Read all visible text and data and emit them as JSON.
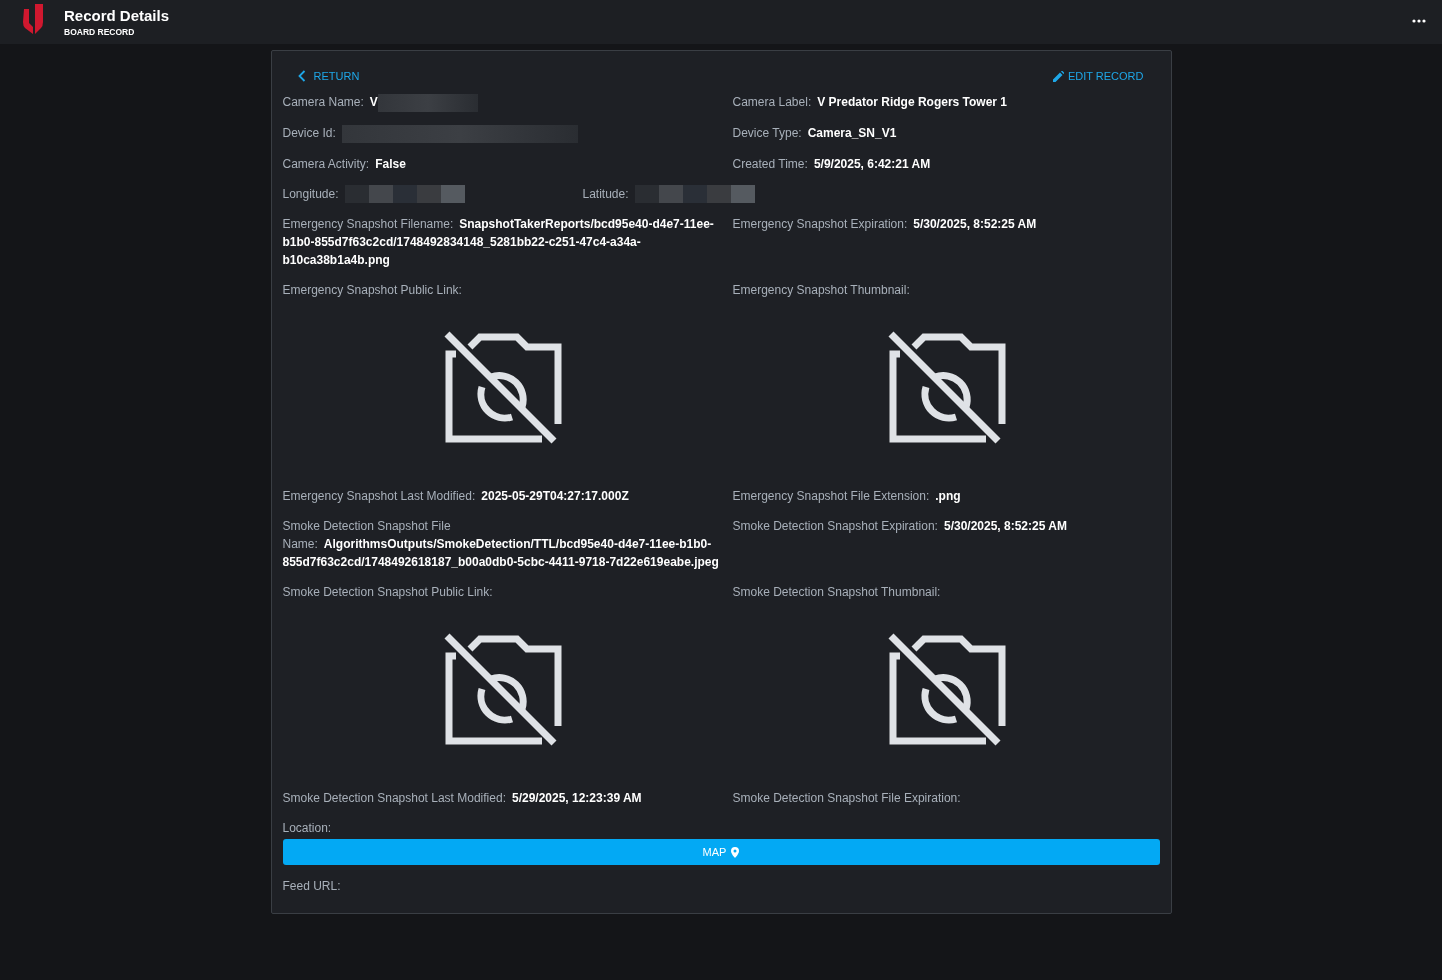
{
  "header": {
    "title": "Record Details",
    "subtitle": "BOARD RECORD"
  },
  "actions": {
    "return": "RETURN",
    "edit": "EDIT RECORD"
  },
  "rows": [
    {
      "kind": "halves",
      "cells": [
        {
          "kind": "text",
          "label": "Camera Name:",
          "value": "V",
          "redacted": true
        },
        {
          "kind": "text",
          "label": "Camera Label:",
          "value": "V Predator Ridge Rogers Tower 1"
        }
      ]
    },
    {
      "kind": "halves",
      "cells": [
        {
          "kind": "text",
          "label": "Device Id:",
          "redacted": true
        },
        {
          "kind": "text",
          "label": "Device Type:",
          "value": "Camera_SN_V1"
        }
      ]
    },
    {
      "kind": "halves",
      "cells": [
        {
          "kind": "text",
          "label": "Camera Activity:",
          "value": "False"
        },
        {
          "kind": "text",
          "label": "Created Time:",
          "value": "5/9/2025, 6:42:21 AM"
        }
      ]
    },
    {
      "kind": "thirds",
      "cells": [
        {
          "kind": "text",
          "label": "Longitude:",
          "redacted": true
        },
        {
          "kind": "text",
          "label": "Latitude:",
          "redacted": true
        }
      ]
    },
    {
      "kind": "halves",
      "cells": [
        {
          "kind": "text",
          "label": "Emergency Snapshot Filename:",
          "value": "SnapshotTakerReports/bcd95e40-d4e7-11ee-b1b0-855d7f63c2cd/1748492834148_5281bb22-c251-47c4-a34a-b10ca38b1a4b.png"
        },
        {
          "kind": "text",
          "label": "Emergency Snapshot Expiration:",
          "value": "5/30/2025, 8:52:25 AM"
        }
      ]
    },
    {
      "kind": "halves",
      "cells": [
        {
          "kind": "image",
          "label": "Emergency Snapshot Public Link:"
        },
        {
          "kind": "image",
          "label": "Emergency Snapshot Thumbnail:"
        }
      ]
    },
    {
      "kind": "halves",
      "cells": [
        {
          "kind": "text",
          "label": "Emergency Snapshot Last Modified:",
          "value": "2025-05-29T04:27:17.000Z"
        },
        {
          "kind": "text",
          "label": "Emergency Snapshot File Extension:",
          "value": ".png"
        }
      ]
    },
    {
      "kind": "halves",
      "cells": [
        {
          "kind": "text",
          "label": "Smoke Detection Snapshot File Name:",
          "value": "AlgorithmsOutputs/SmokeDetection/TTL/bcd95e40-d4e7-11ee-b1b0-855d7f63c2cd/1748492618187_b00a0db0-5cbc-4411-9718-7d22e619eabe.jpeg"
        },
        {
          "kind": "text",
          "label": "Smoke Detection Snapshot Expiration:",
          "value": "5/30/2025, 8:52:25 AM"
        }
      ]
    },
    {
      "kind": "halves",
      "cells": [
        {
          "kind": "image",
          "label": "Smoke Detection Snapshot Public Link:"
        },
        {
          "kind": "image",
          "label": "Smoke Detection Snapshot Thumbnail:"
        }
      ]
    },
    {
      "kind": "halves",
      "cells": [
        {
          "kind": "text",
          "label": "Smoke Detection Snapshot Last Modified:",
          "value": "5/29/2025, 12:23:39 AM"
        },
        {
          "kind": "text",
          "label": "Smoke Detection Snapshot File Expiration:"
        }
      ]
    },
    {
      "kind": "full",
      "cells": [
        {
          "kind": "map",
          "label": "Location:",
          "button": "MAP"
        }
      ]
    },
    {
      "kind": "full",
      "cells": [
        {
          "kind": "text",
          "label": "Feed URL:"
        }
      ]
    }
  ]
}
